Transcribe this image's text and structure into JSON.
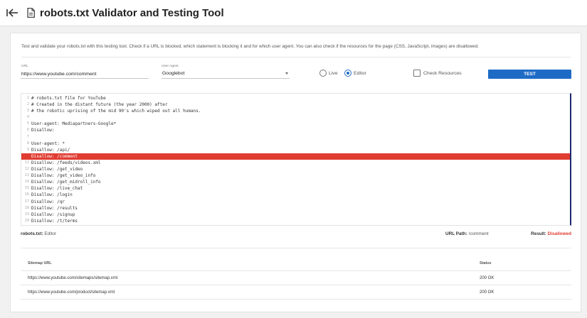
{
  "header": {
    "title": "robots.txt Validator and Testing Tool",
    "back_icon": "back-arrow-icon",
    "doc_icon": "document-icon"
  },
  "description": "Test and validate your robots.txt with this testing tool. Check if a URL is blocked, which statement is blocking it and for which user agent. You can also check if the resources for the page (CSS, JavaScript, images) are disallowed.",
  "form": {
    "url_label": "URL",
    "url_value": "https://www.youtube.com/comment",
    "user_agent_label": "User Agent",
    "user_agent_value": "Googlebot",
    "mode_live_label": "Live",
    "mode_editor_label": "Editor",
    "mode_selected": "Editor",
    "check_resources_label": "Check Resources",
    "check_resources_checked": false,
    "test_button_label": "TEST"
  },
  "editor": {
    "lines": [
      {
        "num": "1",
        "text": "# robots.txt file for YouTube"
      },
      {
        "num": "2",
        "text": "# Created in the distant future (the year 2000) after"
      },
      {
        "num": "3",
        "text": "# the robotic uprising of the mid 90's which wiped out all humans."
      },
      {
        "num": "4",
        "text": ""
      },
      {
        "num": "5",
        "text": "User-agent: Mediapartners-Google*"
      },
      {
        "num": "6",
        "text": "Disallow:"
      },
      {
        "num": "7",
        "text": ""
      },
      {
        "num": "8",
        "text": "User-agent: *"
      },
      {
        "num": "9",
        "text": "Disallow: /api/"
      },
      {
        "num": "",
        "text": "Disallow: /comment",
        "highlighted": true
      },
      {
        "num": "11",
        "text": "Disallow: /feeds/videos.xml"
      },
      {
        "num": "12",
        "text": "Disallow: /get_video"
      },
      {
        "num": "13",
        "text": "Disallow: /get_video_info"
      },
      {
        "num": "14",
        "text": "Disallow: /get_midroll_info"
      },
      {
        "num": "15",
        "text": "Disallow: /live_chat"
      },
      {
        "num": "16",
        "text": "Disallow: /login"
      },
      {
        "num": "17",
        "text": "Disallow: /qr"
      },
      {
        "num": "18",
        "text": "Disallow: /results"
      },
      {
        "num": "19",
        "text": "Disallow: /signup"
      },
      {
        "num": "20",
        "text": "Disallow: /t/terms"
      }
    ]
  },
  "status": {
    "robots_label": "robots.txt:",
    "robots_value": "Editor",
    "url_path_label": "URL Path:",
    "url_path_value": "/comment",
    "result_label": "Result:",
    "result_value": "Disallowed",
    "result_color": "#e03d32"
  },
  "sitemaps": {
    "col_url": "Sitemap URL",
    "col_status": "Status",
    "rows": [
      {
        "url": "https://www.youtube.com/sitemaps/sitemap.xml",
        "status": "200 OK"
      },
      {
        "url": "https://www.youtube.com/product/sitemap.xml",
        "status": "200 OK"
      }
    ]
  },
  "colors": {
    "accent": "#1e6bc6",
    "error": "#e03d32"
  }
}
